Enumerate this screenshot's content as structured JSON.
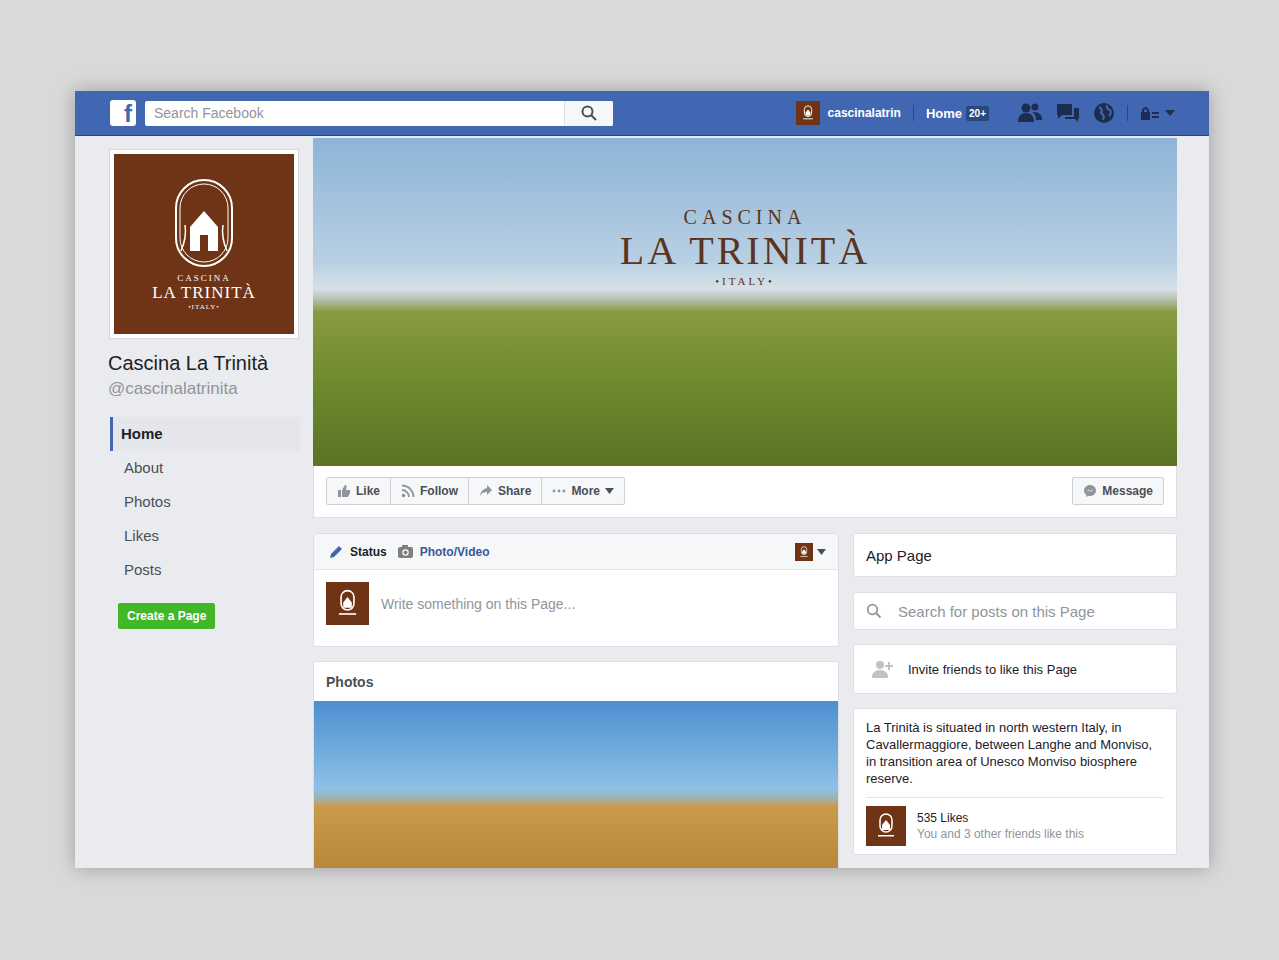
{
  "topbar": {
    "brand": "f",
    "search_placeholder": "Search Facebook",
    "user": "cascinalatrin",
    "home": "Home",
    "home_badge": "20+"
  },
  "page": {
    "name": "Cascina La Trinità",
    "handle": "@cascinalatrinita",
    "logo": {
      "top": "CASCINA",
      "main": "LA TRINITÀ",
      "bottom": "•ITALY•"
    }
  },
  "nav": [
    {
      "label": "Home",
      "selected": true
    },
    {
      "label": "About",
      "selected": false
    },
    {
      "label": "Photos",
      "selected": false
    },
    {
      "label": "Likes",
      "selected": false
    },
    {
      "label": "Posts",
      "selected": false
    }
  ],
  "create_page": "Create a Page",
  "actions": [
    {
      "label": "Like",
      "kind": "like"
    },
    {
      "label": "Follow",
      "kind": "follow"
    },
    {
      "label": "Share",
      "kind": "share"
    },
    {
      "label": "More",
      "kind": "more"
    }
  ],
  "message": "Message",
  "composer": {
    "tabs": [
      {
        "label": "Status",
        "selected": true,
        "kind": "status"
      },
      {
        "label": "Photo/Video",
        "selected": false,
        "kind": "photo"
      }
    ],
    "placeholder": "Write something on this Page..."
  },
  "photos": {
    "title": "Photos"
  },
  "sidebar": {
    "app_page": "App Page",
    "search_placeholder": "Search for posts on this Page",
    "invite": "Invite friends to like this Page",
    "about": "La Trinità is situated in north western Italy, in Cavallermaggiore, between Langhe and Monviso, in transition area of Unesco Monviso biosphere reserve.",
    "likes": "535 Likes",
    "friends_like": "You and 3 other friends like this"
  }
}
